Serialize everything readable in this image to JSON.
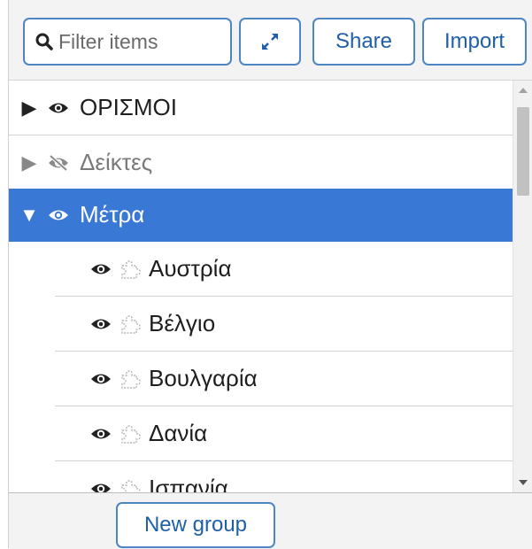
{
  "toolbar": {
    "filter_placeholder": "Filter items",
    "share_label": "Share",
    "import_label": "Import",
    "expand_icon": "expand-arrows-icon",
    "search_icon": "search-icon"
  },
  "tree": {
    "groups": [
      {
        "label": "ΟΡΙΣΜΟΙ",
        "expanded": false,
        "visible": true
      },
      {
        "label": "Δείκτες",
        "expanded": false,
        "visible": false
      },
      {
        "label": "Μέτρα",
        "expanded": true,
        "visible": true,
        "selected": true
      }
    ],
    "children": [
      {
        "label": "Αυστρία"
      },
      {
        "label": "Βέλγιο"
      },
      {
        "label": "Βουλγαρία"
      },
      {
        "label": "Δανία"
      },
      {
        "label": "Ισπανία"
      }
    ]
  },
  "footer": {
    "new_group_label": "New group"
  },
  "colors": {
    "accent": "#3a78d6",
    "button_border": "#4d86c2",
    "group_marker": "#e3001b"
  }
}
